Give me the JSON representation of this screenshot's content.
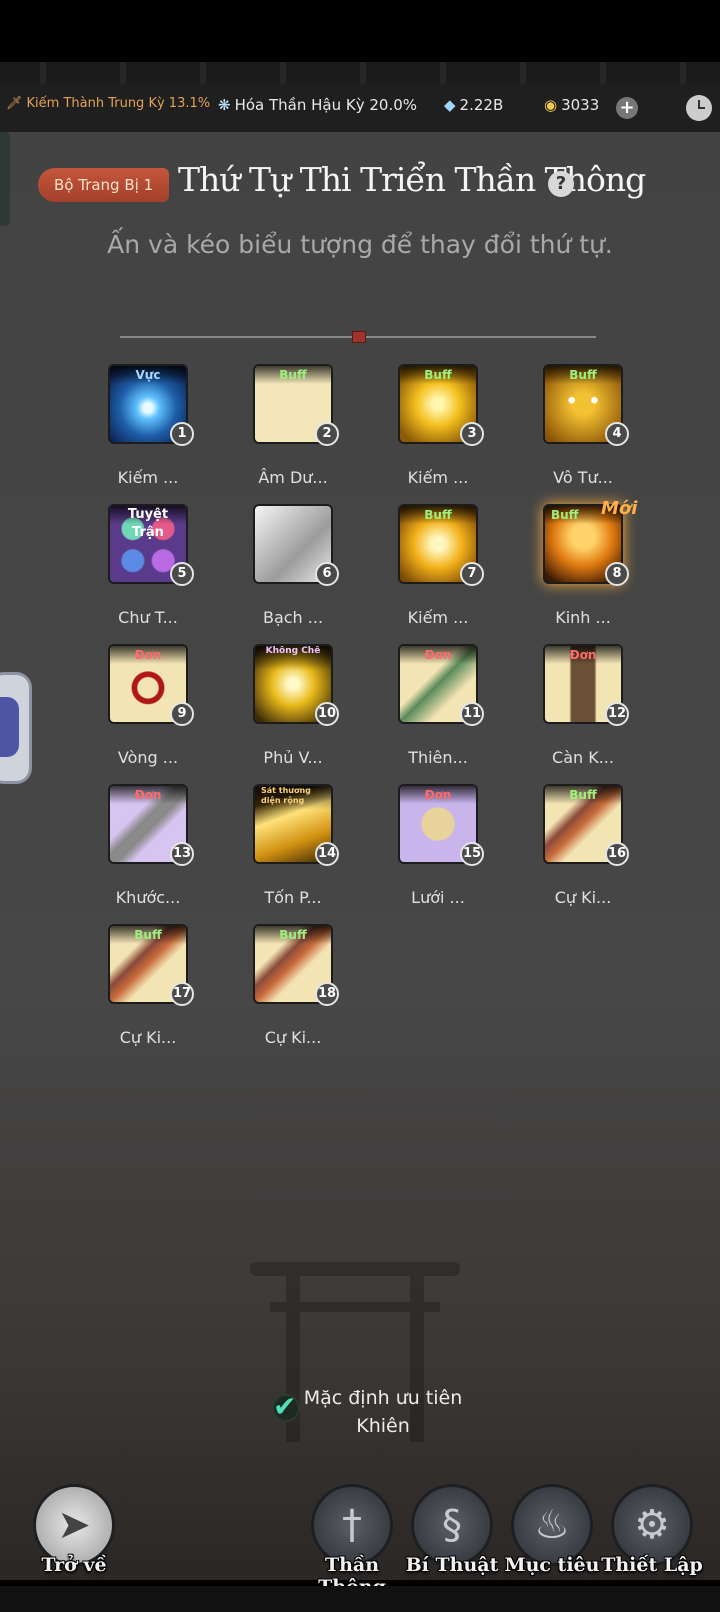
{
  "topbar": {
    "realm1": "Kiếm Thành Trung Kỳ 13.1%",
    "realm2": "Hóa Thần Hậu Kỳ 20.0%",
    "spirit_stones": "2.22B",
    "currency": "3033",
    "add_icon": "plus-icon",
    "clock_icon": "clock-icon"
  },
  "header": {
    "set_badge": "Bộ Trang Bị 1",
    "title": "Thứ Tự Thi Triển Thần Thông",
    "help": "?",
    "subtitle": "Ấn và kéo biểu tượng để thay đổi thứ tự."
  },
  "skills": [
    {
      "num": "1",
      "name": "Kiếm ...",
      "tag": "Vực"
    },
    {
      "num": "2",
      "name": "Âm Dư...",
      "tag": "Buff"
    },
    {
      "num": "3",
      "name": "Kiếm ...",
      "tag": "Buff"
    },
    {
      "num": "4",
      "name": "Vô Tư...",
      "tag": "Buff"
    },
    {
      "num": "5",
      "name": "Chư T...",
      "tag": "Tuyệt Trận"
    },
    {
      "num": "6",
      "name": "Bạch ...",
      "tag": ""
    },
    {
      "num": "7",
      "name": "Kiếm ...",
      "tag": "Buff"
    },
    {
      "num": "8",
      "name": "Kinh ...",
      "tag": "Buff",
      "badge": "Mới"
    },
    {
      "num": "9",
      "name": "Vòng ...",
      "tag": "Đơn"
    },
    {
      "num": "10",
      "name": "Phủ V...",
      "tag": "Khống Chế"
    },
    {
      "num": "11",
      "name": "Thiên...",
      "tag": "Đơn"
    },
    {
      "num": "12",
      "name": "Càn K...",
      "tag": "Đơn"
    },
    {
      "num": "13",
      "name": "Khước...",
      "tag": "Đơn"
    },
    {
      "num": "14",
      "name": "Tốn P...",
      "tag": "Sát thương diện rộng"
    },
    {
      "num": "15",
      "name": "Lưới ...",
      "tag": "Đơn"
    },
    {
      "num": "16",
      "name": "Cự Ki...",
      "tag": "Buff"
    },
    {
      "num": "17",
      "name": "Cự Ki...",
      "tag": "Buff"
    },
    {
      "num": "18",
      "name": "Cự Ki...",
      "tag": "Buff"
    }
  ],
  "default_priority": {
    "label_line1": "Mặc định ưu tiên",
    "label_line2": "Khiên",
    "checked": true
  },
  "nav": {
    "back": "Trở về",
    "than_thong": "Thần Thông",
    "bi_thuat": "Bí Thuật",
    "muc_tieu": "Mục tiêu",
    "thiet_lap": "Thiết Lập"
  }
}
